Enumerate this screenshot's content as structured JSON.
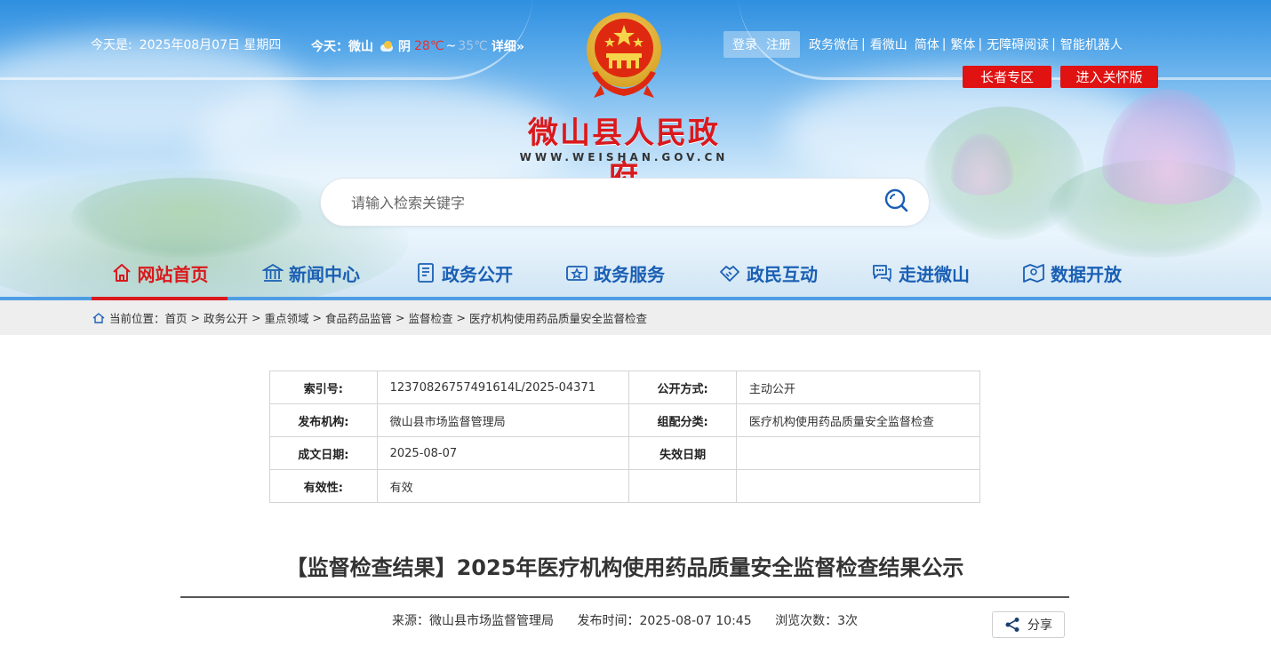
{
  "header": {
    "date_label": "今天是:",
    "date_value": "2025年08月07日 星期四",
    "weather": {
      "label": "今天：",
      "city": "微山",
      "condition": "阴",
      "high": "28℃",
      "separator": "~",
      "low": "35℃",
      "detail": "详细»"
    },
    "login": "登录",
    "register": "注册",
    "links": [
      "政务微信",
      "看微山",
      "简体",
      "繁体",
      "无障碍阅读",
      "智能机器人"
    ],
    "elder_button": "长者专区",
    "care_button": "进入关怀版",
    "site_title": "微山县人民政府",
    "site_url": "WWW.WEISHAN.GOV.CN",
    "search_placeholder": "请输入检索关键字"
  },
  "nav": {
    "items": [
      {
        "label": "网站首页",
        "icon": "home-icon"
      },
      {
        "label": "新闻中心",
        "icon": "building-icon"
      },
      {
        "label": "政务公开",
        "icon": "document-icon"
      },
      {
        "label": "政务服务",
        "icon": "service-icon"
      },
      {
        "label": "政民互动",
        "icon": "handshake-icon"
      },
      {
        "label": "走进微山",
        "icon": "chat-icon"
      },
      {
        "label": "数据开放",
        "icon": "map-icon"
      }
    ]
  },
  "breadcrumb": {
    "label": "当前位置：",
    "items": [
      "首页",
      "政务公开",
      "重点领域",
      "食品药品监管",
      "监督检查",
      "医疗机构使用药品质量安全监督检查"
    ]
  },
  "info_table": {
    "index_label": "索引号:",
    "index_value": "12370826757491614L/2025-04371",
    "disclosure_label": "公开方式:",
    "disclosure_value": "主动公开",
    "publisher_label": "发布机构:",
    "publisher_value": "微山县市场监督管理局",
    "category_label": "组配分类:",
    "category_value": "医疗机构使用药品质量安全监督检查",
    "date_label": "成文日期:",
    "date_value": "2025-08-07",
    "expire_label": "失效日期",
    "expire_value": "",
    "validity_label": "有效性:",
    "validity_value": "有效"
  },
  "article": {
    "title": "【监督检查结果】2025年医疗机构使用药品质量安全监督检查结果公示",
    "source": "来源：微山县市场监督管理局",
    "publish_time": "发布时间：2025-08-07 10:45",
    "views": "浏览次数：3次",
    "share": "分享"
  },
  "colors": {
    "brand_red": "#d9191d",
    "nav_blue": "#1a5fb4",
    "accent_blue": "#4e9de4"
  }
}
